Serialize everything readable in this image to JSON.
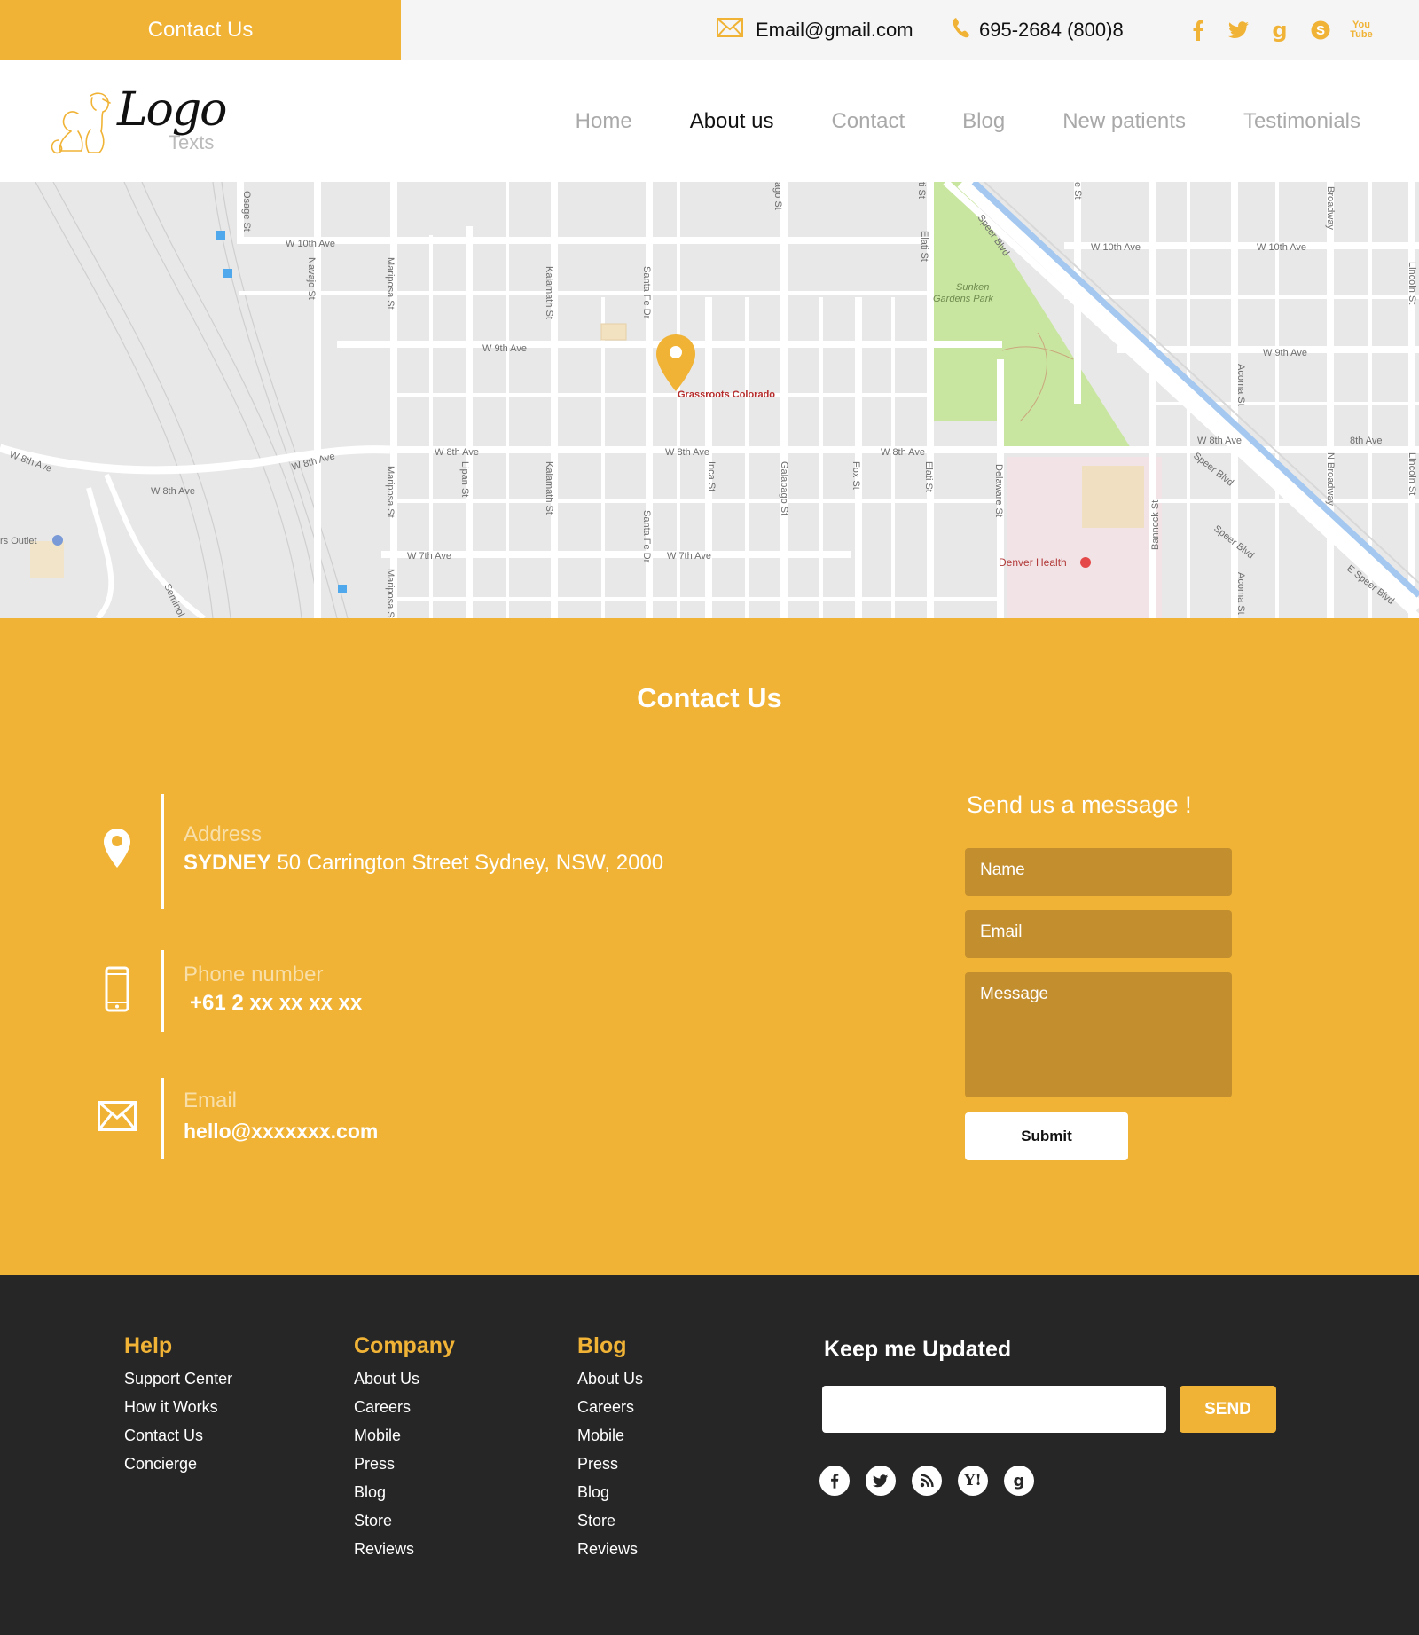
{
  "topbar": {
    "contact_label": "Contact Us",
    "email": "Email@gmail.com",
    "phone": "695-2684 (800)8",
    "social": [
      "facebook-icon",
      "twitter-icon",
      "google-icon",
      "skype-icon",
      "youtube-icon"
    ],
    "youtube_top": "You",
    "youtube_bottom": "Tube"
  },
  "logo": {
    "word": "Logo",
    "sub": "Texts"
  },
  "nav": {
    "items": [
      "Home",
      "About us",
      "Contact",
      "Blog",
      "New patients",
      "Testimonials"
    ],
    "active": "About us"
  },
  "map": {
    "streets_h": [
      "W 10th Ave",
      "W 9th Ave",
      "W 8th Ave",
      "W 7th Ave",
      "8th Ave"
    ],
    "streets_v": [
      "Osage St",
      "Navajo St",
      "Mariposa St",
      "Kalamath St",
      "Santa Fe Dr",
      "Lipan St",
      "Inca St",
      "Galapago St",
      "Fox St",
      "Elati St",
      "Delaware St",
      "Bannock St",
      "Acoma St",
      "N Broadway",
      "Broadway",
      "Lincoln St"
    ],
    "speer": [
      "Speer Blvd",
      "E Speer Blvd"
    ],
    "park": [
      "Sunken",
      "Gardens Park"
    ],
    "place_pin": "Grassroots Colorado",
    "place_hospital": "Denver Health",
    "place_outlet": "rs Outlet",
    "misc_labels": [
      "Seminol",
      "ago St",
      "ti St",
      "e St",
      "8th Ave"
    ]
  },
  "contact": {
    "title": "Contact Us",
    "address_label": "Address",
    "address_city": "SYDNEY",
    "address_rest": " 50 Carrington Street Sydney, NSW, 2000",
    "phone_label": "Phone number",
    "phone_value": "+61 2 xx xx xx xx",
    "email_label": "Email",
    "email_value": "hello@xxxxxxx.com",
    "form_title": "Send us a message !",
    "name_placeholder": "Name",
    "email_placeholder": "Email",
    "message_placeholder": "Message",
    "submit_label": "Submit"
  },
  "footer": {
    "help": {
      "title": "Help",
      "links": [
        "Support Center",
        "How it Works",
        "Contact Us",
        "Concierge"
      ]
    },
    "company": {
      "title": "Company",
      "links": [
        "About Us",
        "Careers",
        "Mobile",
        "Press",
        "Blog",
        "Store",
        "Reviews"
      ]
    },
    "blog": {
      "title": "Blog",
      "links": [
        "About Us",
        "Careers",
        "Mobile",
        "Press",
        "Blog",
        "Store",
        "Reviews"
      ]
    },
    "keep_title": "Keep me Updated",
    "send_label": "SEND",
    "social": [
      "facebook-icon",
      "twitter-icon",
      "rss-icon",
      "yahoo-icon",
      "google-icon"
    ]
  },
  "colors": {
    "accent": "#f0b336",
    "accent_dark": "#c38e2e",
    "footer_bg": "#262626",
    "map_bg": "#e8e8e8",
    "park": "#c9e6a1",
    "river": "#a4c8f0"
  }
}
